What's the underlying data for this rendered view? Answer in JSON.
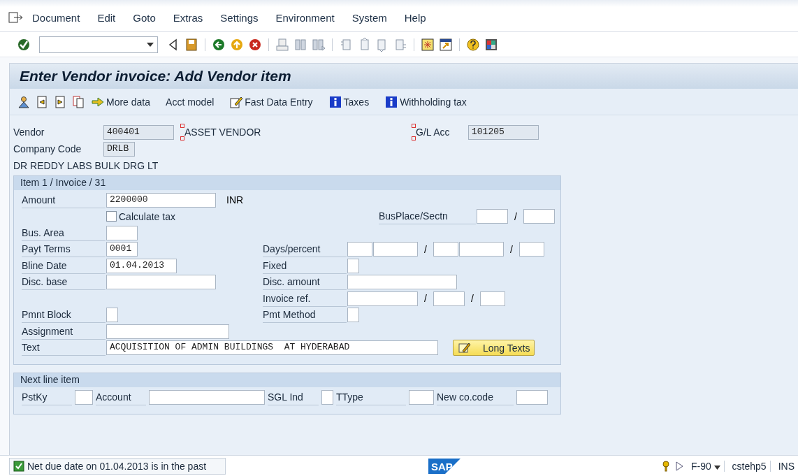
{
  "menu": [
    "Document",
    "Edit",
    "Goto",
    "Extras",
    "Settings",
    "Environment",
    "System",
    "Help"
  ],
  "title": "Enter Vendor invoice: Add Vendor item",
  "app_toolbar": [
    {
      "kind": "person"
    },
    {
      "kind": "prev"
    },
    {
      "kind": "next"
    },
    {
      "kind": "copy"
    },
    {
      "kind": "more",
      "label": "More data"
    },
    {
      "kind": "text",
      "label": "Acct model"
    },
    {
      "kind": "fast",
      "label": "Fast Data Entry"
    },
    {
      "kind": "info",
      "label": "Taxes"
    },
    {
      "kind": "info",
      "label": "Withholding tax"
    }
  ],
  "header": {
    "vendor": {
      "label": "Vendor",
      "value": "400401",
      "name": "ASSET VENDOR"
    },
    "gl": {
      "label": "G/L Acc",
      "value": "101205"
    },
    "company": {
      "label": "Company Code",
      "value": "DRLB"
    },
    "company_name": "DR REDDY LABS BULK DRG LT"
  },
  "item_group": {
    "title": "Item 1 / Invoice / 31",
    "rows": [
      {
        "left": {
          "label": "Amount",
          "fields": [
            {
              "kind": "amount",
              "value": "2200000"
            },
            {
              "kind": "unit",
              "text": "INR"
            }
          ]
        }
      },
      {
        "left": {
          "kind": "checkbox",
          "label": "Calculate tax",
          "checked": false
        },
        "right": {
          "kind": "trailing",
          "label": "BusPlace/Sectn",
          "fields": [
            {
              "kind": "key"
            },
            {
              "kind": "slash",
              "text": "/"
            },
            {
              "kind": "key"
            }
          ]
        }
      },
      {
        "left": {
          "label": "Bus. Area",
          "fields": [
            {
              "kind": "key"
            }
          ]
        }
      },
      {
        "left": {
          "label": "Payt Terms",
          "fields": [
            {
              "kind": "key",
              "value": "0001"
            }
          ]
        },
        "right": {
          "label": "Days/percent",
          "fields": [
            {
              "kind": "days"
            },
            {
              "kind": "pct"
            },
            {
              "kind": "slash",
              "text": "/"
            },
            {
              "kind": "days"
            },
            {
              "kind": "pct"
            },
            {
              "kind": "slash",
              "text": "/"
            },
            {
              "kind": "days"
            }
          ]
        }
      },
      {
        "left": {
          "label": "Bline Date",
          "fields": [
            {
              "kind": "date",
              "value": "01.04.2013"
            }
          ]
        },
        "right": {
          "label": "Fixed",
          "fields": [
            {
              "kind": "flag"
            }
          ]
        }
      },
      {
        "left": {
          "label": "Disc. base",
          "fields": [
            {
              "kind": "amount"
            }
          ]
        },
        "right": {
          "label": "Disc. amount",
          "fields": [
            {
              "kind": "amount"
            }
          ]
        }
      },
      {
        "right": {
          "label": "Invoice ref.",
          "fields": [
            {
              "kind": "date"
            },
            {
              "kind": "slash",
              "text": "/"
            },
            {
              "kind": "key"
            },
            {
              "kind": "slash",
              "text": "/"
            },
            {
              "kind": "days"
            }
          ]
        }
      },
      {
        "left": {
          "label": "Pmnt Block",
          "fields": [
            {
              "kind": "flag"
            }
          ]
        },
        "right": {
          "label": "Pmt Method",
          "fields": [
            {
              "kind": "flag"
            }
          ]
        }
      },
      {
        "left": {
          "label": "Assignment",
          "fields": [
            {
              "kind": "assign"
            }
          ]
        }
      },
      {
        "left": {
          "label": "Text",
          "fields": [
            {
              "kind": "text",
              "value": "ACQUISITION OF ADMIN BUILDINGS  AT HYDERABAD"
            },
            {
              "kind": "button",
              "text": "Long Texts"
            }
          ]
        }
      }
    ]
  },
  "next_group": {
    "title": "Next line item",
    "fields": [
      {
        "label": "PstKy",
        "kind": "pstky"
      },
      {
        "label": "Account",
        "kind": "account"
      },
      {
        "label": "SGL Ind",
        "kind": "flag"
      },
      {
        "label": "TType",
        "kind": "days"
      },
      {
        "label": "New co.code",
        "kind": "key"
      }
    ]
  },
  "status_bar": {
    "logo": "SAP",
    "message": "Net due date on 01.04.2013 is in the past",
    "transaction": "F-90",
    "server": "cstehp5",
    "mode": "INS"
  }
}
